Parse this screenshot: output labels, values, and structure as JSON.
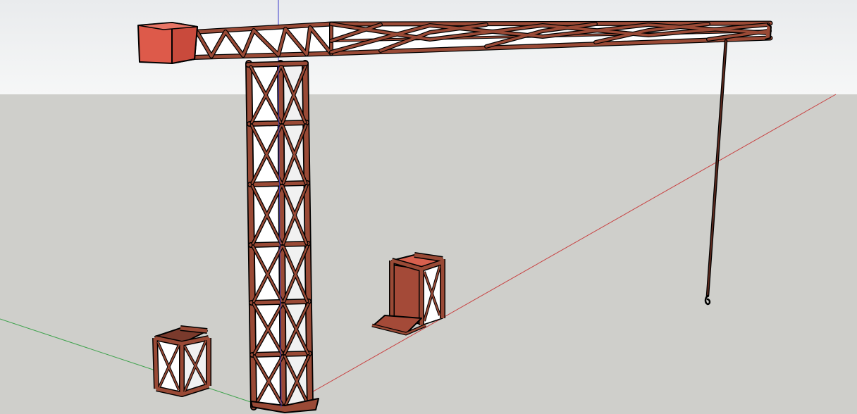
{
  "scene": {
    "sky_color_top": "#e9ebed",
    "sky_color_bottom": "#f6f7f7",
    "ground_color": "#cfcfcb",
    "truss_color": "#9a4a36",
    "truss_dark": "#5e2a1f",
    "panel_color": "#ffffff",
    "counterweight_color": "#dd5a4a",
    "axis_red": "#d64545",
    "axis_green": "#3fa34d",
    "axis_blue": "#3a3acb",
    "objects": [
      "tower-crane",
      "crane-mast",
      "crane-jib",
      "counterweight",
      "hook-cable",
      "crane-hook",
      "truss-box",
      "open-crate"
    ]
  }
}
